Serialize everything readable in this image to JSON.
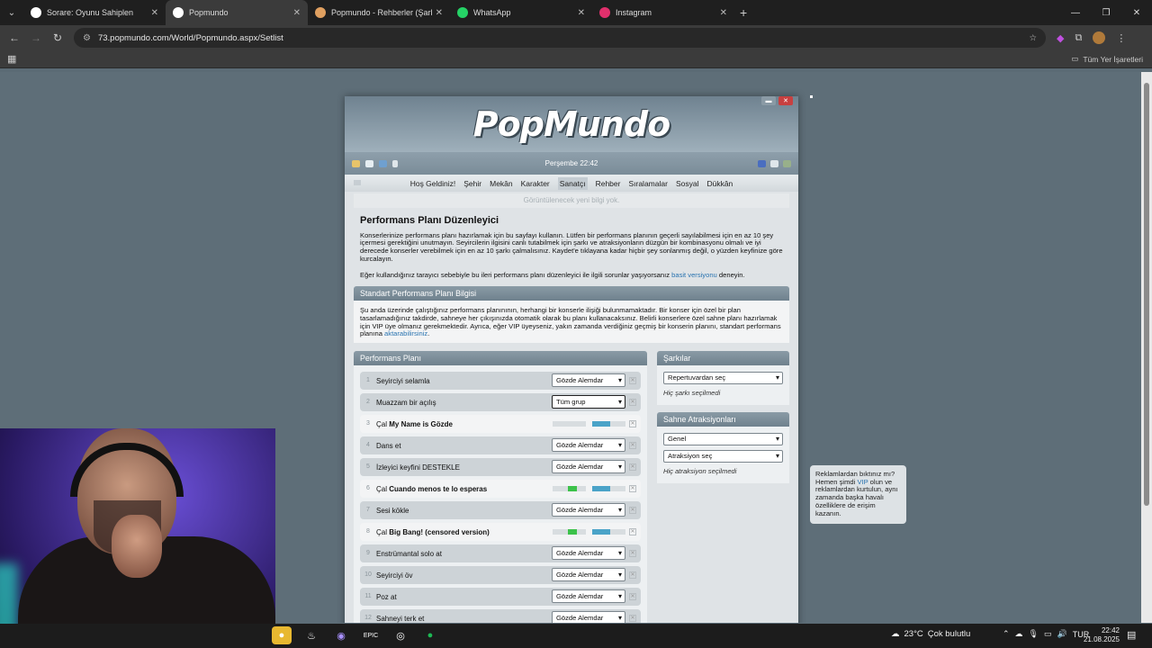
{
  "browser": {
    "tabs": [
      {
        "title": "Sorare: Oyunu Sahiplen",
        "active": false,
        "icon_color": "#ffffff"
      },
      {
        "title": "Popmundo",
        "active": true,
        "icon_color": "#ffffff"
      },
      {
        "title": "Popmundo - Rehberler (Şarkı B",
        "active": false,
        "icon_color": "#e0a060"
      },
      {
        "title": "WhatsApp",
        "active": false,
        "icon_color": "#25d366"
      },
      {
        "title": "Instagram",
        "active": false,
        "icon_color": "#e1306c"
      }
    ],
    "url": "73.popmundo.com/World/Popmundo.aspx/Setlist",
    "all_bookmarks": "Tüm Yer İşaretleri"
  },
  "site": {
    "logo": "PopMundo",
    "datetime": "Perşembe 22:42",
    "menu": [
      "Hoş Geldiniz!",
      "Şehir",
      "Mekân",
      "Karakter",
      "Sanatçı",
      "Rehber",
      "Sıralamalar",
      "Sosyal",
      "Dükkân"
    ],
    "notice": "Görüntülenecek yeni bilgi yok.",
    "title": "Performans Planı Düzenleyici",
    "intro": "Konserlerinize performans planı hazırlamak için bu sayfayı kullanın. Lütfen bir performans planının geçerli sayılabilmesi için en az 10 şey içermesi gerektiğini unutmayın. Seyircilerin ilgisini canlı tutabilmek için şarkı ve atraksiyonların düzgün bir kombinasyonu olmalı ve iyi derecede konserler verebilmek için en az 10 şarkı çalmalısınız. Kaydet'e tıklayana kadar hiçbir şey sonlanmış değil, o yüzden keyfinize göre kurcalayın.",
    "browser_note_pre": "Eğer kullandığınız tarayıcı sebebiyle bu ileri performans planı düzenleyici ile ilgili sorunlar yaşıyorsanız",
    "browser_note_link": "basit versiyonu",
    "browser_note_post": "deneyin.",
    "standard_head": "Standart Performans Planı Bilgisi",
    "standard_text": "Şu anda üzerinde çalıştığınız performans planınının, herhangi bir konserle ilişiği bulunmamaktadır. Bir konser için özel bir plan tasarlamadığınız takdirde, sahneye her çıkışınızda otomatik olarak bu planı kullanacaksınız. Belirli konserlere özel sahne planı hazırlamak için VIP üye olmanız gerekmektedir. Ayrıca, eğer VIP üyeyseniz, yakın zamanda verdiğiniz geçmiş bir konserin planını, standart performans planına",
    "standard_link": "aktarabilirsiniz",
    "plan_head": "Performans Planı",
    "plan_rows": [
      {
        "num": "1",
        "prefix": "",
        "label": "Seyirciyi selamla",
        "select": "Gözde Alemdar",
        "type": "action"
      },
      {
        "num": "2",
        "prefix": "",
        "label": "Muazzam bir açılış",
        "select": "Tüm grup",
        "type": "action_focused"
      },
      {
        "num": "3",
        "prefix": "Çal",
        "label": "My Name is Gözde",
        "select": "",
        "type": "song",
        "bar1": 0.0,
        "bar2": 0.55
      },
      {
        "num": "4",
        "prefix": "",
        "label": "Dans et",
        "select": "Gözde Alemdar",
        "type": "action"
      },
      {
        "num": "5",
        "prefix": "",
        "label": "İzleyici keyfini DESTEKLE",
        "select": "Gözde Alemdar",
        "type": "action"
      },
      {
        "num": "6",
        "prefix": "Çal",
        "label": "Cuando menos te lo esperas",
        "select": "",
        "type": "song",
        "bar1": 0.6,
        "bar2": 0.55
      },
      {
        "num": "7",
        "prefix": "",
        "label": "Sesi kökle",
        "select": "Gözde Alemdar",
        "type": "action"
      },
      {
        "num": "8",
        "prefix": "Çal",
        "label": "Big Bang! (censored version)",
        "select": "",
        "type": "song",
        "bar1": 0.6,
        "bar2": 0.55
      },
      {
        "num": "9",
        "prefix": "",
        "label": "Enstrümantal solo at",
        "select": "Gözde Alemdar",
        "type": "action"
      },
      {
        "num": "10",
        "prefix": "",
        "label": "Seyirciyi öv",
        "select": "Gözde Alemdar",
        "type": "action"
      },
      {
        "num": "11",
        "prefix": "",
        "label": "Poz at",
        "select": "Gözde Alemdar",
        "type": "action"
      },
      {
        "num": "12",
        "prefix": "",
        "label": "Sahneyi terk et",
        "select": "Gözde Alemdar",
        "type": "action"
      }
    ],
    "songs_head": "Şarkılar",
    "songs_select": "Repertuvardan seç",
    "songs_note": "Hiç şarkı seçilmedi",
    "attr_head": "Sahne Atraksiyonları",
    "attr_select1": "Genel",
    "attr_select2": "Atraksiyon seç",
    "attr_note": "Hiç atraksiyon seçilmedi",
    "ad_pre": "Reklamlardan bıktınız mı? Hemen şimdi",
    "ad_link": "VIP",
    "ad_post": "olun ve reklamlardan kurtulun, aynı zamanda başka havalı özelliklere de erişim kazanın."
  },
  "taskbar": {
    "temperature": "23°C",
    "weather": "Çok bulutlu",
    "lang": "TUR",
    "time": "22:42",
    "date": "21.08.2025"
  },
  "colors": {
    "bar_green": "#3cc24a",
    "bar_blue": "#4aa3c8",
    "bar_blue_dim": "#9cc9da"
  }
}
